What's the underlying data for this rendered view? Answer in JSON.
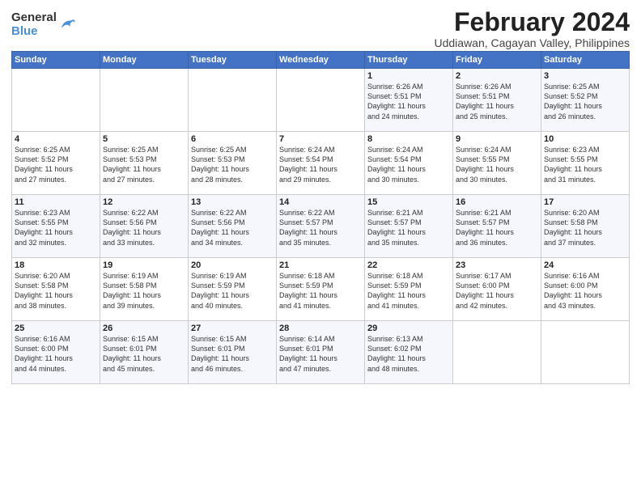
{
  "logo": {
    "general": "General",
    "blue": "Blue"
  },
  "title": "February 2024",
  "subtitle": "Uddiawan, Cagayan Valley, Philippines",
  "days_of_week": [
    "Sunday",
    "Monday",
    "Tuesday",
    "Wednesday",
    "Thursday",
    "Friday",
    "Saturday"
  ],
  "weeks": [
    [
      {
        "day": "",
        "info": ""
      },
      {
        "day": "",
        "info": ""
      },
      {
        "day": "",
        "info": ""
      },
      {
        "day": "",
        "info": ""
      },
      {
        "day": "1",
        "info": "Sunrise: 6:26 AM\nSunset: 5:51 PM\nDaylight: 11 hours\nand 24 minutes."
      },
      {
        "day": "2",
        "info": "Sunrise: 6:26 AM\nSunset: 5:51 PM\nDaylight: 11 hours\nand 25 minutes."
      },
      {
        "day": "3",
        "info": "Sunrise: 6:25 AM\nSunset: 5:52 PM\nDaylight: 11 hours\nand 26 minutes."
      }
    ],
    [
      {
        "day": "4",
        "info": "Sunrise: 6:25 AM\nSunset: 5:52 PM\nDaylight: 11 hours\nand 27 minutes."
      },
      {
        "day": "5",
        "info": "Sunrise: 6:25 AM\nSunset: 5:53 PM\nDaylight: 11 hours\nand 27 minutes."
      },
      {
        "day": "6",
        "info": "Sunrise: 6:25 AM\nSunset: 5:53 PM\nDaylight: 11 hours\nand 28 minutes."
      },
      {
        "day": "7",
        "info": "Sunrise: 6:24 AM\nSunset: 5:54 PM\nDaylight: 11 hours\nand 29 minutes."
      },
      {
        "day": "8",
        "info": "Sunrise: 6:24 AM\nSunset: 5:54 PM\nDaylight: 11 hours\nand 30 minutes."
      },
      {
        "day": "9",
        "info": "Sunrise: 6:24 AM\nSunset: 5:55 PM\nDaylight: 11 hours\nand 30 minutes."
      },
      {
        "day": "10",
        "info": "Sunrise: 6:23 AM\nSunset: 5:55 PM\nDaylight: 11 hours\nand 31 minutes."
      }
    ],
    [
      {
        "day": "11",
        "info": "Sunrise: 6:23 AM\nSunset: 5:55 PM\nDaylight: 11 hours\nand 32 minutes."
      },
      {
        "day": "12",
        "info": "Sunrise: 6:22 AM\nSunset: 5:56 PM\nDaylight: 11 hours\nand 33 minutes."
      },
      {
        "day": "13",
        "info": "Sunrise: 6:22 AM\nSunset: 5:56 PM\nDaylight: 11 hours\nand 34 minutes."
      },
      {
        "day": "14",
        "info": "Sunrise: 6:22 AM\nSunset: 5:57 PM\nDaylight: 11 hours\nand 35 minutes."
      },
      {
        "day": "15",
        "info": "Sunrise: 6:21 AM\nSunset: 5:57 PM\nDaylight: 11 hours\nand 35 minutes."
      },
      {
        "day": "16",
        "info": "Sunrise: 6:21 AM\nSunset: 5:57 PM\nDaylight: 11 hours\nand 36 minutes."
      },
      {
        "day": "17",
        "info": "Sunrise: 6:20 AM\nSunset: 5:58 PM\nDaylight: 11 hours\nand 37 minutes."
      }
    ],
    [
      {
        "day": "18",
        "info": "Sunrise: 6:20 AM\nSunset: 5:58 PM\nDaylight: 11 hours\nand 38 minutes."
      },
      {
        "day": "19",
        "info": "Sunrise: 6:19 AM\nSunset: 5:58 PM\nDaylight: 11 hours\nand 39 minutes."
      },
      {
        "day": "20",
        "info": "Sunrise: 6:19 AM\nSunset: 5:59 PM\nDaylight: 11 hours\nand 40 minutes."
      },
      {
        "day": "21",
        "info": "Sunrise: 6:18 AM\nSunset: 5:59 PM\nDaylight: 11 hours\nand 41 minutes."
      },
      {
        "day": "22",
        "info": "Sunrise: 6:18 AM\nSunset: 5:59 PM\nDaylight: 11 hours\nand 41 minutes."
      },
      {
        "day": "23",
        "info": "Sunrise: 6:17 AM\nSunset: 6:00 PM\nDaylight: 11 hours\nand 42 minutes."
      },
      {
        "day": "24",
        "info": "Sunrise: 6:16 AM\nSunset: 6:00 PM\nDaylight: 11 hours\nand 43 minutes."
      }
    ],
    [
      {
        "day": "25",
        "info": "Sunrise: 6:16 AM\nSunset: 6:00 PM\nDaylight: 11 hours\nand 44 minutes."
      },
      {
        "day": "26",
        "info": "Sunrise: 6:15 AM\nSunset: 6:01 PM\nDaylight: 11 hours\nand 45 minutes."
      },
      {
        "day": "27",
        "info": "Sunrise: 6:15 AM\nSunset: 6:01 PM\nDaylight: 11 hours\nand 46 minutes."
      },
      {
        "day": "28",
        "info": "Sunrise: 6:14 AM\nSunset: 6:01 PM\nDaylight: 11 hours\nand 47 minutes."
      },
      {
        "day": "29",
        "info": "Sunrise: 6:13 AM\nSunset: 6:02 PM\nDaylight: 11 hours\nand 48 minutes."
      },
      {
        "day": "",
        "info": ""
      },
      {
        "day": "",
        "info": ""
      }
    ]
  ]
}
